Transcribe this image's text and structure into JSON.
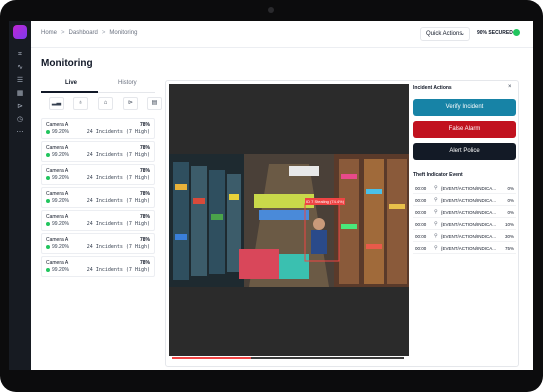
{
  "breadcrumb": {
    "home": "Home",
    "dashboard": "Dashboard",
    "current": "Monitoring",
    "separator": ">"
  },
  "topbar": {
    "quick_actions": "Quick Actions",
    "status": "90% SECURED",
    "status_color": "#22c55e"
  },
  "page": {
    "title": "Monitoring"
  },
  "tabs": {
    "live": "Live",
    "history": "History"
  },
  "filters": [
    {
      "icon": "signal-icon"
    },
    {
      "icon": "bulb-icon"
    },
    {
      "icon": "lock-icon"
    },
    {
      "icon": "truck-icon"
    },
    {
      "icon": "calendar-icon"
    }
  ],
  "cameras": [
    {
      "name": "Camera A",
      "uptime": "99.20%",
      "score": "78%",
      "incidents": "24 Incidents (7 High)"
    },
    {
      "name": "Camera A",
      "uptime": "99.20%",
      "score": "78%",
      "incidents": "24 Incidents (7 High)"
    },
    {
      "name": "Camera A",
      "uptime": "99.20%",
      "score": "78%",
      "incidents": "24 Incidents (7 High)"
    },
    {
      "name": "Camera A",
      "uptime": "99.20%",
      "score": "78%",
      "incidents": "24 Incidents (7 High)"
    },
    {
      "name": "Camera A",
      "uptime": "99.20%",
      "score": "78%",
      "incidents": "24 Incidents (7 High)"
    },
    {
      "name": "Camera A",
      "uptime": "99.20%",
      "score": "78%",
      "incidents": "24 Incidents (7 High)"
    },
    {
      "name": "Camera A",
      "uptime": "99.20%",
      "score": "78%",
      "incidents": "24 Incidents (7 High)"
    }
  ],
  "video": {
    "detection_label": "ID 7  Stealing (74.4%)",
    "progress": 0.34
  },
  "incident": {
    "title": "Incident Actions",
    "close": "×",
    "verify": "Verify Incident",
    "false_alarm": "False Alarm",
    "alert_police": "Alert Police",
    "events_title": "Theft Indicator Event",
    "events": [
      {
        "time": "00:00",
        "path": "{EVENT/ACTION/INDICA...",
        "value": "0%"
      },
      {
        "time": "00:00",
        "path": "{EVENT/ACTION/INDICA...",
        "value": "0%"
      },
      {
        "time": "00:00",
        "path": "{EVENT/ACTION/INDICA...",
        "value": "0%"
      },
      {
        "time": "00:00",
        "path": "{EVENT/ACTION/INDICA...",
        "value": "10%"
      },
      {
        "time": "00:00",
        "path": "{EVENT/ACTION/INDICA...",
        "value": "30%"
      },
      {
        "time": "00:00",
        "path": "{EVENT/ACTION/INDICA...",
        "value": "75%"
      }
    ]
  },
  "colors": {
    "verify": "#1783a6",
    "false_alarm": "#c1121f",
    "alert_police": "#131a26",
    "detection": "#ef4444"
  }
}
